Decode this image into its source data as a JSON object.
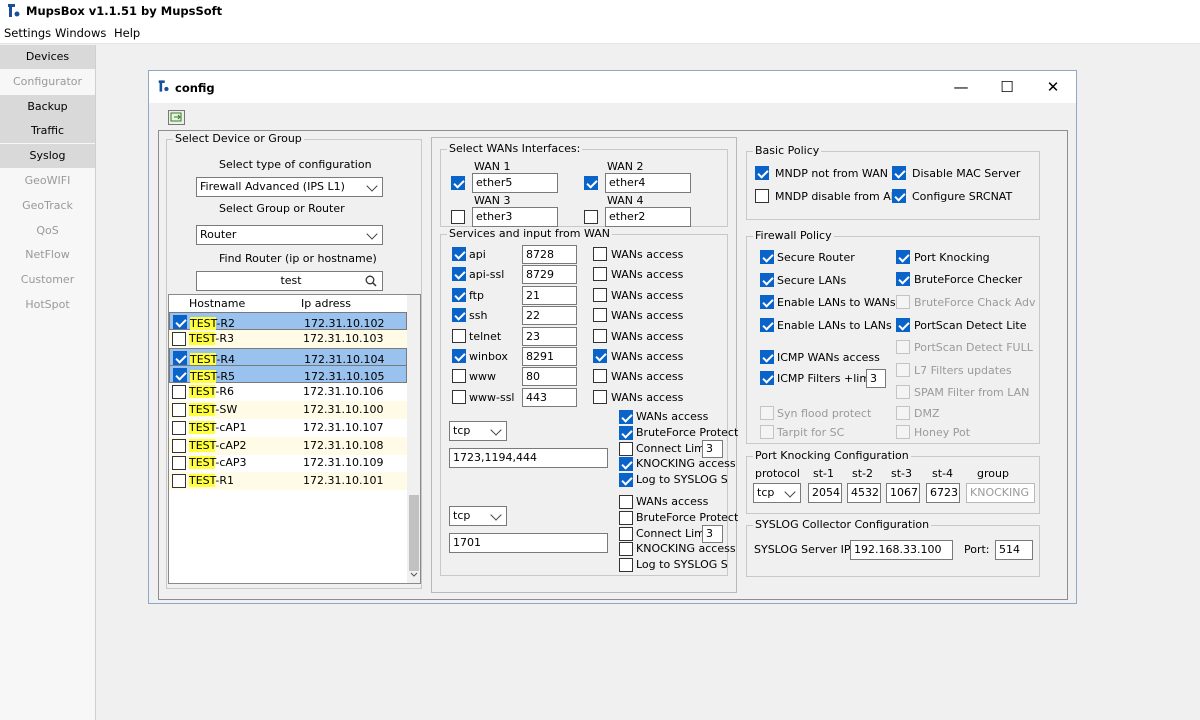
{
  "app": {
    "title": "MupsBox v1.1.51  by MupsSoft"
  },
  "menu": [
    "Settings",
    "Windows",
    "Help"
  ],
  "sidebar": [
    {
      "label": "Devices",
      "active": true
    },
    {
      "label": "Configurator",
      "active": false
    },
    {
      "label": "Backup",
      "active": true
    },
    {
      "label": "Traffic",
      "active": true
    },
    {
      "label": "Syslog",
      "active": true
    },
    {
      "label": "GeoWIFI",
      "active": false
    },
    {
      "label": "GeoTrack",
      "active": false
    },
    {
      "label": "QoS",
      "active": false
    },
    {
      "label": "NetFlow",
      "active": false
    },
    {
      "label": "Customer",
      "active": false
    },
    {
      "label": "HotSpot",
      "active": false
    }
  ],
  "window": {
    "title": "config",
    "min": "—",
    "max": "☐",
    "close": "✕"
  },
  "device": {
    "legend": "Select Device or Group",
    "type_label": "Select type of configuration",
    "type_value": "Firewall Advanced (IPS L1)",
    "group_label": "Select Group or Router",
    "group_value": "Router",
    "find_label": "Find Router (ip or hostname)",
    "find_value": "test",
    "col_host": "Hostname",
    "col_ip": "Ip adress",
    "rows": [
      {
        "pre": "TEST",
        "post": "-R2",
        "ip": "172.31.10.102",
        "checked": true,
        "selected": true
      },
      {
        "pre": "TEST",
        "post": "-R3",
        "ip": "172.31.10.103",
        "checked": false,
        "selected": false
      },
      {
        "pre": "TEST",
        "post": "-R4",
        "ip": "172.31.10.104",
        "checked": true,
        "selected": true
      },
      {
        "pre": "TEST",
        "post": "-R5",
        "ip": "172.31.10.105",
        "checked": true,
        "selected": true
      },
      {
        "pre": "TEST",
        "post": "-R6",
        "ip": "172.31.10.106",
        "checked": false,
        "selected": false
      },
      {
        "pre": "TEST",
        "post": "-SW",
        "ip": "172.31.10.100",
        "checked": false,
        "selected": false
      },
      {
        "pre": "TEST",
        "post": "-cAP1",
        "ip": "172.31.10.107",
        "checked": false,
        "selected": false
      },
      {
        "pre": "TEST",
        "post": "-cAP2",
        "ip": "172.31.10.108",
        "checked": false,
        "selected": false
      },
      {
        "pre": "TEST",
        "post": "-cAP3",
        "ip": "172.31.10.109",
        "checked": false,
        "selected": false
      },
      {
        "pre": "TEST",
        "post": "-R1",
        "ip": "172.31.10.101",
        "checked": false,
        "selected": false
      }
    ]
  },
  "wans": {
    "legend": "Select WANs Interfaces:",
    "items": [
      {
        "label": "WAN 1",
        "value": "ether5",
        "checked": true
      },
      {
        "label": "WAN 2",
        "value": "ether4",
        "checked": true
      },
      {
        "label": "WAN 3",
        "value": "ether3",
        "checked": false
      },
      {
        "label": "WAN 4",
        "value": "ether2",
        "checked": false
      }
    ]
  },
  "services": {
    "legend": "Services and input from WAN",
    "wans_label": "WANs access",
    "items": [
      {
        "name": "api",
        "checked": true,
        "port": "8728",
        "wan": false
      },
      {
        "name": "api-ssl",
        "checked": true,
        "port": "8729",
        "wan": false
      },
      {
        "name": "ftp",
        "checked": true,
        "port": "21",
        "wan": false
      },
      {
        "name": "ssh",
        "checked": true,
        "port": "22",
        "wan": false
      },
      {
        "name": "telnet",
        "checked": false,
        "port": "23",
        "wan": false
      },
      {
        "name": "winbox",
        "checked": true,
        "port": "8291",
        "wan": true
      },
      {
        "name": "www",
        "checked": false,
        "port": "80",
        "wan": false
      },
      {
        "name": "www-ssl",
        "checked": false,
        "port": "443",
        "wan": false
      }
    ],
    "custom": [
      {
        "proto": "tcp",
        "ports": "1723,1194,444",
        "limit": "3",
        "opts": [
          {
            "label": "WANs access",
            "checked": true
          },
          {
            "label": "BruteForce Protect",
            "checked": true
          },
          {
            "label": "Connect Limit",
            "checked": false
          },
          {
            "label": "KNOCKING access",
            "checked": true
          },
          {
            "label": "Log to SYSLOG S",
            "checked": true
          }
        ]
      },
      {
        "proto": "tcp",
        "ports": "1701",
        "limit": "3",
        "opts": [
          {
            "label": "WANs access",
            "checked": false
          },
          {
            "label": "BruteForce Protect",
            "checked": false
          },
          {
            "label": "Connect Limit",
            "checked": false
          },
          {
            "label": "KNOCKING access",
            "checked": false
          },
          {
            "label": "Log to SYSLOG S",
            "checked": false
          }
        ]
      }
    ]
  },
  "basic": {
    "legend": "Basic Policy",
    "items": [
      {
        "label": "MNDP not from WAN",
        "checked": true
      },
      {
        "label": "Disable MAC Server",
        "checked": true
      },
      {
        "label": "MNDP disable from ALL",
        "checked": false
      },
      {
        "label": "Configure SRCNAT",
        "checked": true
      }
    ]
  },
  "fw": {
    "legend": "Firewall Policy",
    "left": [
      {
        "label": "Secure Router",
        "checked": true,
        "dis": false
      },
      {
        "label": "Secure LANs",
        "checked": true,
        "dis": false
      },
      {
        "label": "Enable LANs to WANs",
        "checked": true,
        "dis": false
      },
      {
        "label": "Enable LANs to LANs",
        "checked": true,
        "dis": false
      },
      {
        "label": "ICMP WANs access",
        "checked": true,
        "dis": false
      },
      {
        "label": "ICMP Filters +limit:",
        "checked": true,
        "dis": false
      },
      {
        "label": "Syn flood protect",
        "checked": false,
        "dis": true
      },
      {
        "label": "Tarpit for SC",
        "checked": false,
        "dis": true
      }
    ],
    "right": [
      {
        "label": "Port Knocking",
        "checked": true,
        "dis": false
      },
      {
        "label": "BruteForce Checker",
        "checked": true,
        "dis": false
      },
      {
        "label": "BruteForce Chack Adv",
        "checked": false,
        "dis": true
      },
      {
        "label": "PortScan Detect Lite",
        "checked": true,
        "dis": false
      },
      {
        "label": "PortScan Detect FULL",
        "checked": false,
        "dis": true
      },
      {
        "label": "L7 Filters updates",
        "checked": false,
        "dis": true
      },
      {
        "label": "SPAM Filter from LAN",
        "checked": false,
        "dis": true
      },
      {
        "label": "DMZ",
        "checked": false,
        "dis": true
      },
      {
        "label": "Honey Pot",
        "checked": false,
        "dis": true
      }
    ],
    "icmp_limit": "3"
  },
  "knock": {
    "legend": "Port Knocking Configuration",
    "headers": [
      "protocol",
      "st-1",
      "st-2",
      "st-3",
      "st-4",
      "group"
    ],
    "proto": "tcp",
    "st": [
      "2054",
      "4532",
      "1067",
      "6723"
    ],
    "group": "KNOCKING"
  },
  "syslog": {
    "legend": "SYSLOG Collector Configuration",
    "ip_label": "SYSLOG Server IP:",
    "ip": "192.168.33.100",
    "port_label": "Port:",
    "port": "514"
  }
}
